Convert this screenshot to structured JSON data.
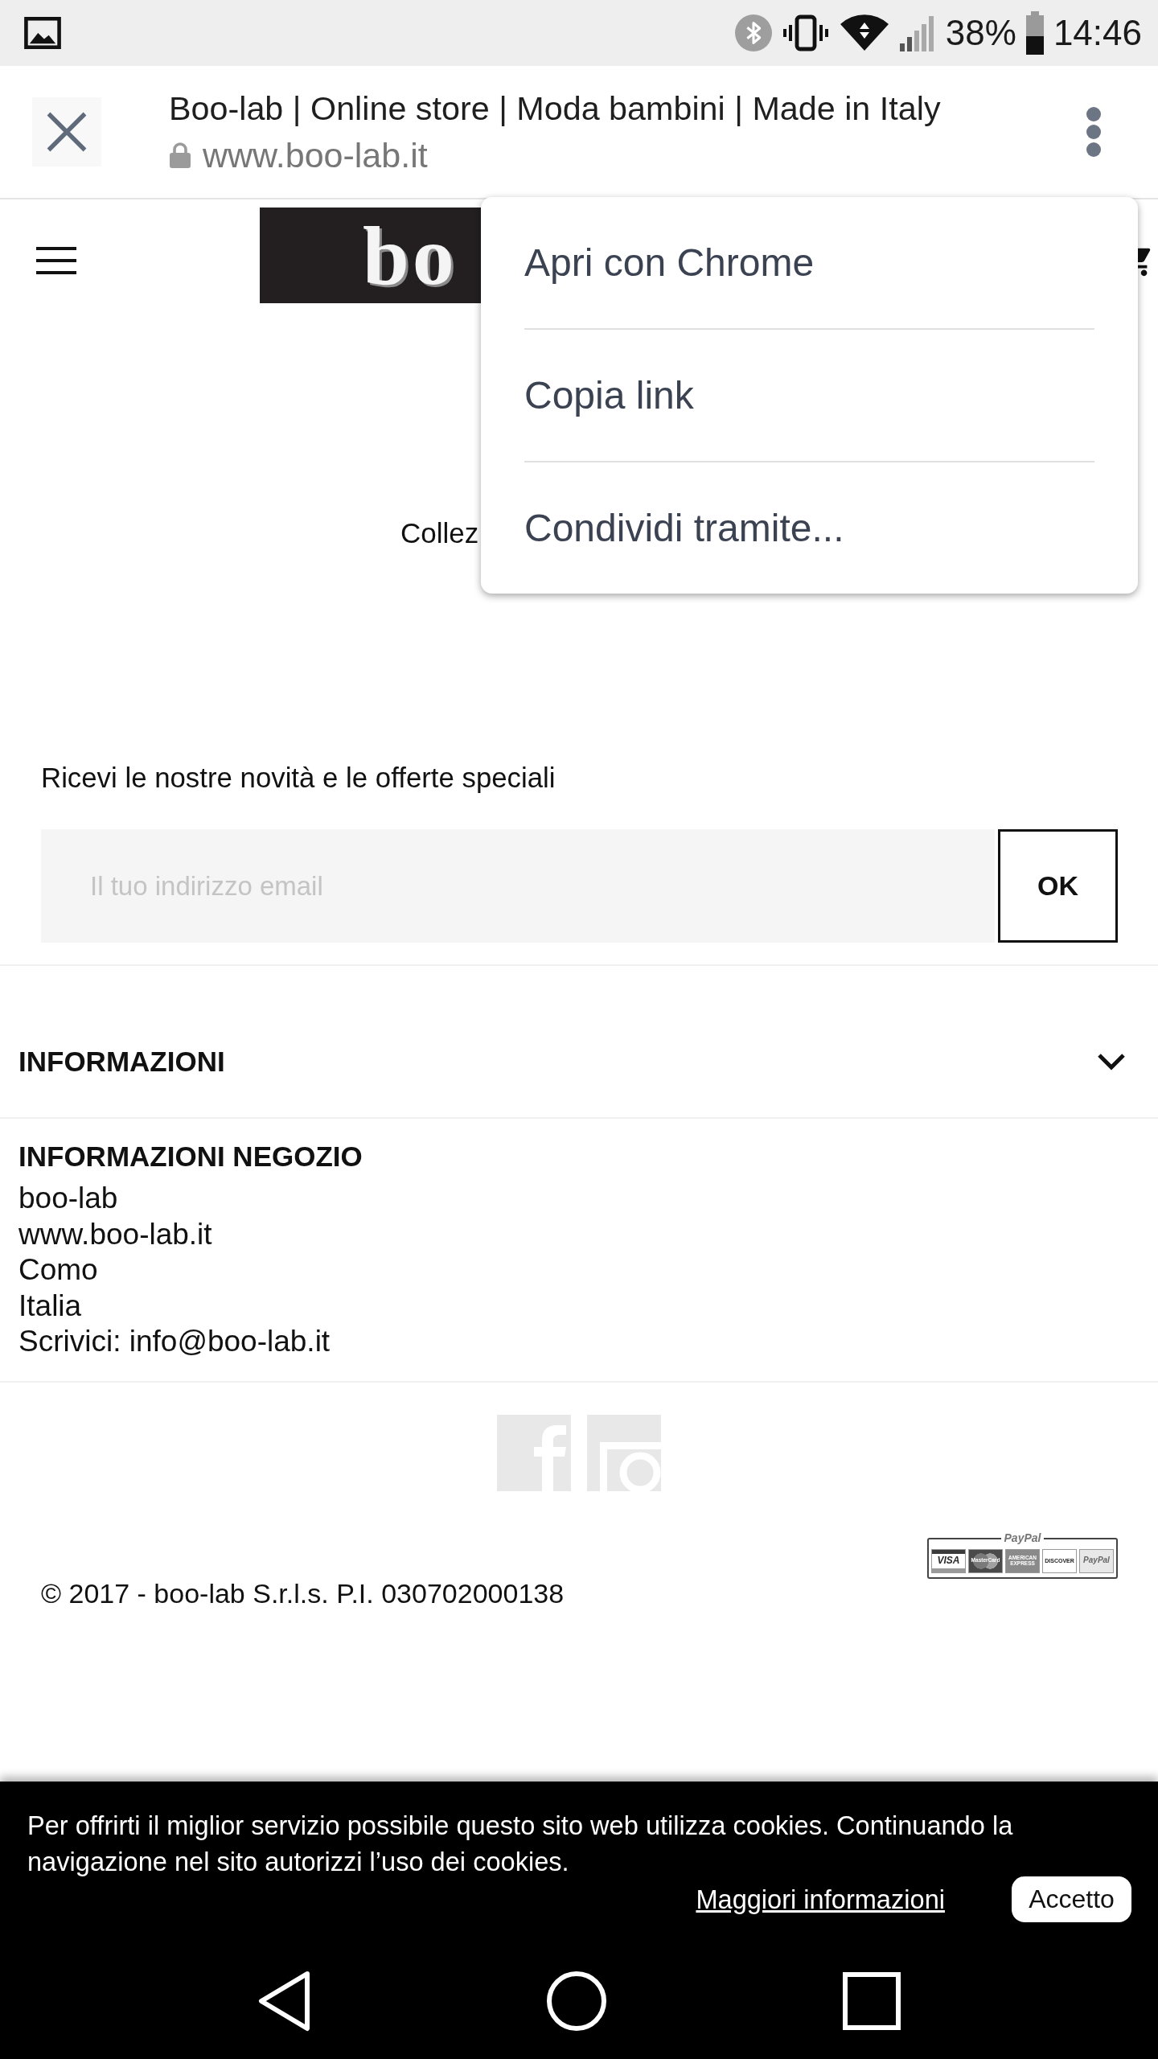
{
  "status_bar": {
    "battery_percent": "38%",
    "time": "14:46"
  },
  "custom_tab": {
    "title": "Boo-lab | Online store | Moda bambini | Made in Italy",
    "url": "www.boo-lab.it"
  },
  "overflow_menu": {
    "items": [
      "Apri con Chrome",
      "Copia link",
      "Condividi tramite..."
    ]
  },
  "site_header": {
    "logo": "bo"
  },
  "collection_text": "Collez",
  "newsletter": {
    "label": "Ricevi le nostre novità e le offerte speciali",
    "placeholder": "Il tuo indirizzo email",
    "button": "OK"
  },
  "sections": [
    {
      "title": "INFORMAZIONI",
      "expanded": false
    }
  ],
  "store_info": {
    "title": "INFORMAZIONI NEGOZIO",
    "lines": [
      "boo-lab",
      "www.boo-lab.it",
      "Como",
      "Italia",
      "Scrivici: info@boo-lab.it"
    ]
  },
  "payment_badge": {
    "title": "PayPal",
    "cards": [
      {
        "kind": "visa",
        "label": "VISA"
      },
      {
        "kind": "mastercard",
        "label": "MasterCard"
      },
      {
        "kind": "amex",
        "label": "AMERICAN EXPRESS"
      },
      {
        "kind": "discover",
        "label": "DISCOVER"
      },
      {
        "kind": "paypal",
        "label": "PayPal"
      }
    ]
  },
  "copyright": "© 2017 - boo-lab S.r.l.s. P.I. 030702000138",
  "cookie_banner": {
    "message": "Per offrirti il miglior servizio possibile questo sito web utilizza cookies. Continuando la navigazione nel sito autorizzi l’uso dei cookies.",
    "link": "Maggiori informazioni",
    "button": "Accetto"
  }
}
